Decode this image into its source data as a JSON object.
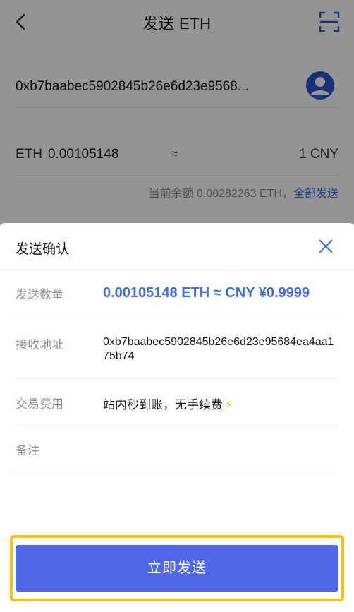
{
  "nav": {
    "title": "发送 ETH"
  },
  "recipient": {
    "address": "0xb7baabec5902845b26e6d23e9568..."
  },
  "amount": {
    "currency": "ETH",
    "value": "0.00105148",
    "approx": "≈",
    "fiat": "1 CNY"
  },
  "balance": {
    "text": "当前余额 0.00282263 ETH，",
    "send_all_label": "全部发送"
  },
  "confirm": {
    "title": "发送确认",
    "rows": {
      "amount": {
        "label": "发送数量",
        "value": "0.00105148 ETH ≈ CNY ¥0.9999"
      },
      "address": {
        "label": "接收地址",
        "value": "0xb7baabec5902845b26e6d23e95684ea4aa175b74"
      },
      "fee": {
        "label": "交易费用",
        "value": "站内秒到账，无手续费",
        "icon": "lightning-icon"
      },
      "memo": {
        "label": "备注",
        "value": ""
      }
    },
    "send_button_label": "立即发送"
  },
  "colors": {
    "accent": "#3b6cf0",
    "button": "#4f68e7",
    "highlight": "#f4c20d"
  }
}
